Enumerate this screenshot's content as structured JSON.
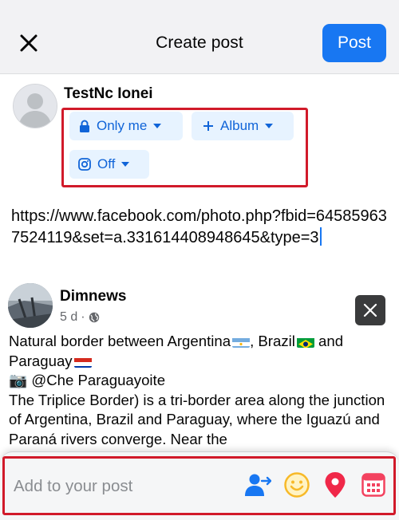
{
  "header": {
    "title": "Create post",
    "post_label": "Post",
    "close_icon": "close-icon"
  },
  "author": {
    "name": "TestNc Ionei"
  },
  "audience": {
    "privacy_label": "Only me",
    "album_label": "Album",
    "instagram_label": "Off"
  },
  "composer": {
    "text": "https://www.facebook.com/photo.php?fbid=645859637524119&set=a.331614408948645&type=3"
  },
  "shared_post": {
    "author": "Dimnews",
    "time": "5 d",
    "separator": "·",
    "line1": "Natural border between Argentina",
    "line1_mid": ", Brazil",
    "line1_end": " and",
    "line2": "Paraguay",
    "credit_icon": "📷",
    "credit": " @Che Paraguayoite",
    "body": "The Triplice Border) is a tri-border area along the junction of Argentina, Brazil and Paraguay, where the Iguazú and Paraná rivers converge. Near the"
  },
  "bottom_bar": {
    "placeholder": "Add to your post",
    "tools": [
      "tag-people-icon",
      "feeling-icon",
      "location-icon",
      "event-icon"
    ]
  },
  "colors": {
    "accent": "#1877f2",
    "chip_bg": "#e7f3ff",
    "highlight_border": "#d11a2a",
    "feeling": "#f7b928",
    "location": "#f02849",
    "event": "#f3425f"
  }
}
